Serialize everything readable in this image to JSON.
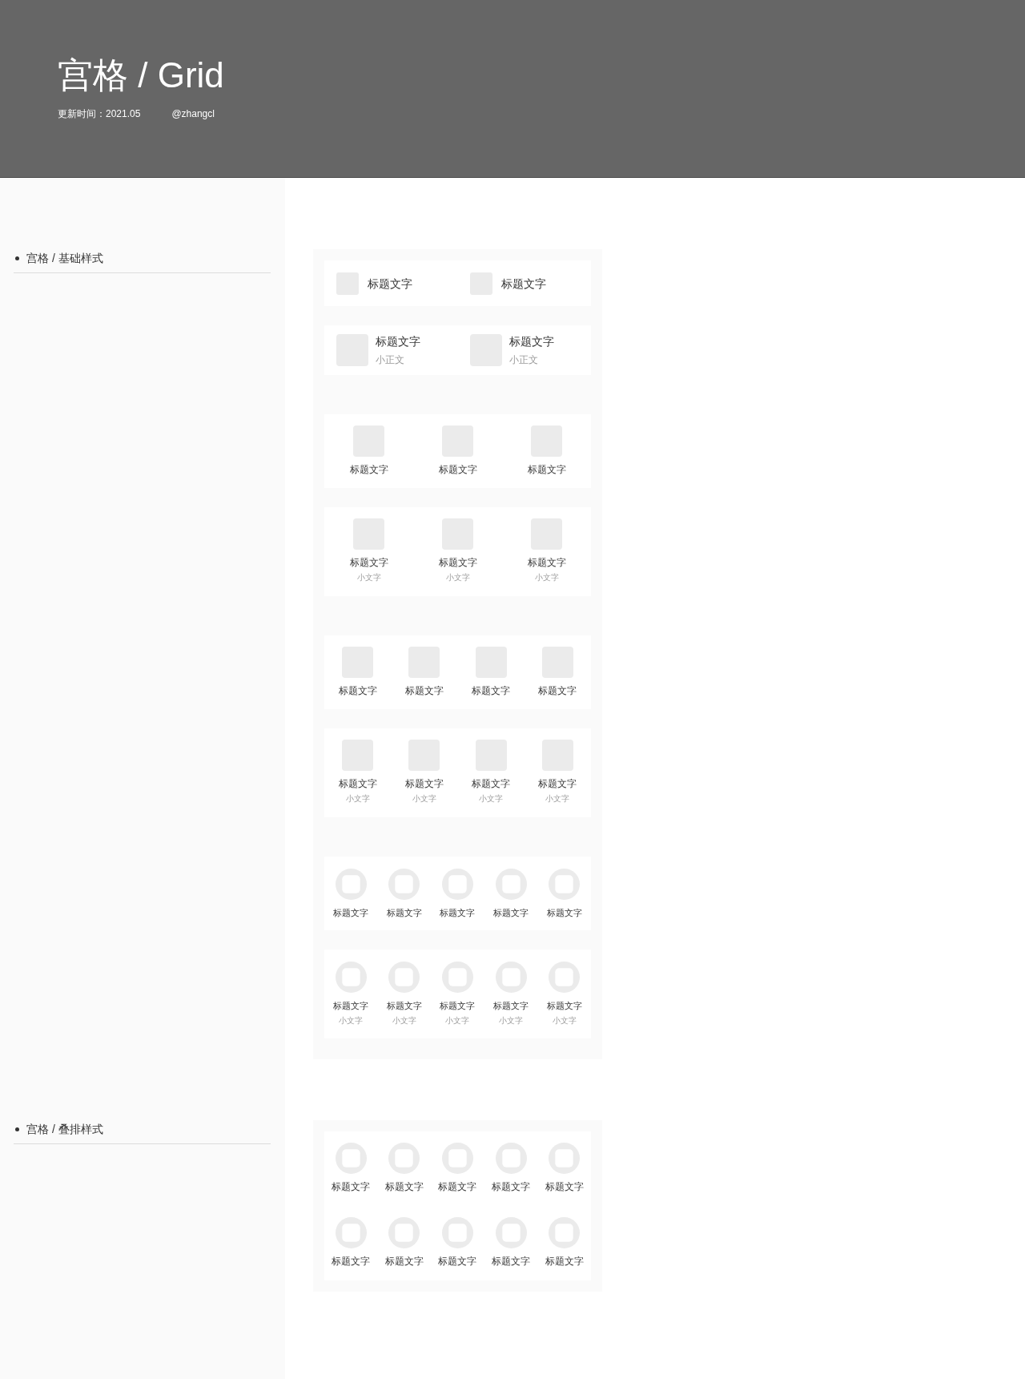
{
  "header": {
    "title": "宫格 / Grid",
    "updated": "更新时间：2021.05",
    "author": "@zhangcl"
  },
  "sections": [
    {
      "title": "宫格 / 基础样式",
      "groups": [
        {
          "cards": [
            {
              "kind": "inline",
              "items": [
                {
                  "title": "标题文字"
                },
                {
                  "title": "标题文字"
                }
              ]
            },
            {
              "kind": "inline",
              "items": [
                {
                  "title": "标题文字",
                  "subtitle": "小正文"
                },
                {
                  "title": "标题文字",
                  "subtitle": "小正文"
                }
              ]
            }
          ]
        },
        {
          "cards": [
            {
              "kind": "tile",
              "items": [
                {
                  "title": "标题文字"
                },
                {
                  "title": "标题文字"
                },
                {
                  "title": "标题文字"
                }
              ]
            },
            {
              "kind": "tile",
              "items": [
                {
                  "title": "标题文字",
                  "subtitle": "小文字"
                },
                {
                  "title": "标题文字",
                  "subtitle": "小文字"
                },
                {
                  "title": "标题文字",
                  "subtitle": "小文字"
                }
              ]
            }
          ]
        },
        {
          "cards": [
            {
              "kind": "tile",
              "items": [
                {
                  "title": "标题文字"
                },
                {
                  "title": "标题文字"
                },
                {
                  "title": "标题文字"
                },
                {
                  "title": "标题文字"
                }
              ]
            },
            {
              "kind": "tile",
              "items": [
                {
                  "title": "标题文字",
                  "subtitle": "小文字"
                },
                {
                  "title": "标题文字",
                  "subtitle": "小文字"
                },
                {
                  "title": "标题文字",
                  "subtitle": "小文字"
                },
                {
                  "title": "标题文字",
                  "subtitle": "小文字"
                }
              ]
            }
          ]
        },
        {
          "cards": [
            {
              "kind": "ring",
              "items": [
                {
                  "title": "标题文字"
                },
                {
                  "title": "标题文字"
                },
                {
                  "title": "标题文字"
                },
                {
                  "title": "标题文字"
                },
                {
                  "title": "标题文字"
                }
              ]
            },
            {
              "kind": "ring",
              "items": [
                {
                  "title": "标题文字",
                  "subtitle": "小文字"
                },
                {
                  "title": "标题文字",
                  "subtitle": "小文字"
                },
                {
                  "title": "标题文字",
                  "subtitle": "小文字"
                },
                {
                  "title": "标题文字",
                  "subtitle": "小文字"
                },
                {
                  "title": "标题文字",
                  "subtitle": "小文字"
                }
              ]
            }
          ]
        }
      ]
    },
    {
      "title": "宫格 / 叠排样式",
      "groups": [
        {
          "cards": [
            {
              "kind": "stacked",
              "rows": [
                [
                  {
                    "title": "标题文字"
                  },
                  {
                    "title": "标题文字"
                  },
                  {
                    "title": "标题文字"
                  },
                  {
                    "title": "标题文字"
                  },
                  {
                    "title": "标题文字"
                  }
                ],
                [
                  {
                    "title": "标题文字"
                  },
                  {
                    "title": "标题文字"
                  },
                  {
                    "title": "标题文字"
                  },
                  {
                    "title": "标题文字"
                  },
                  {
                    "title": "标题文字"
                  }
                ]
              ]
            }
          ]
        }
      ]
    }
  ]
}
